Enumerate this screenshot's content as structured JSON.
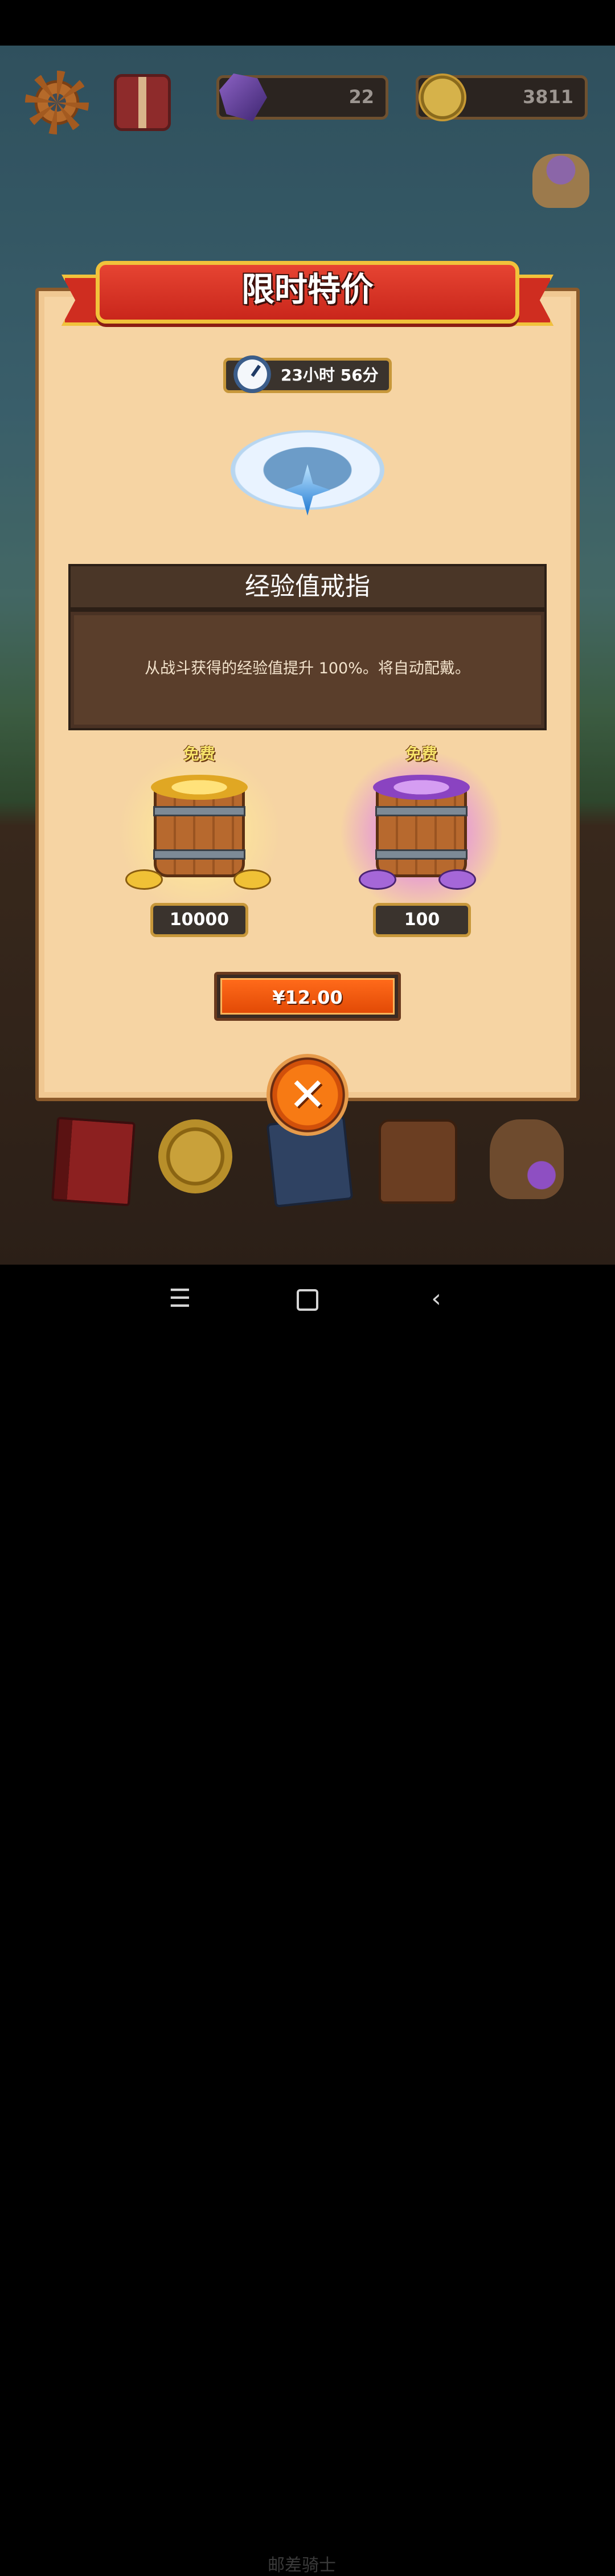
{
  "hud": {
    "gems": "22",
    "coins": "3811"
  },
  "dialog": {
    "title": "限时特价",
    "timer": "23小时 56分",
    "item_name": "经验值戒指",
    "item_description": "从战斗获得的经验值提升 100%。将自动配戴。",
    "rewards": [
      {
        "label": "免费",
        "amount": "10000",
        "type": "coins"
      },
      {
        "label": "免费",
        "amount": "100",
        "type": "gems"
      }
    ],
    "price": "¥12.00",
    "close_symbol": "✕"
  },
  "bottom_nav": {
    "icons": [
      "book-icon",
      "star-medal-icon",
      "card-deck-icon",
      "backpack-icon",
      "treasure-bag-icon"
    ]
  },
  "system_nav": {
    "menu_symbol": "☰",
    "back_symbol": "‹",
    "watermark": "邮差骑士"
  },
  "colors": {
    "ribbon": "#d42a1d",
    "panel": "#f6d4a3",
    "buy_button": "#f05a0e",
    "close_button": "#f07012"
  }
}
